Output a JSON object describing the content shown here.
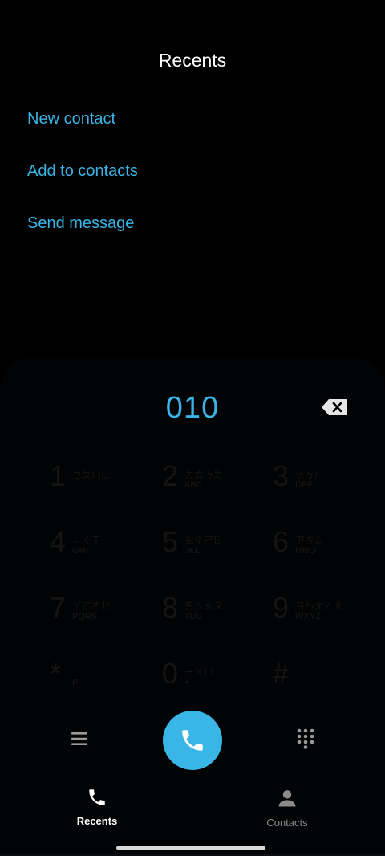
{
  "header": {
    "title": "Recents"
  },
  "menu": {
    "items": [
      {
        "label": "New contact"
      },
      {
        "label": "Add to contacts"
      },
      {
        "label": "Send message"
      }
    ]
  },
  "dialer": {
    "number": "010",
    "keys": [
      {
        "digit": "1",
        "zh": "ㄅㄆㄇㄈ",
        "en": ""
      },
      {
        "digit": "2",
        "zh": "ㄉㄊㄋㄌ",
        "en": "ABC"
      },
      {
        "digit": "3",
        "zh": "ㄍㄎㄏ",
        "en": "DEF"
      },
      {
        "digit": "4",
        "zh": "ㄐㄑㄒ",
        "en": "GHI"
      },
      {
        "digit": "5",
        "zh": "ㄓㄔㄕㄖ",
        "en": "JKL"
      },
      {
        "digit": "6",
        "zh": "ㄗㄘㄙ",
        "en": "MNO"
      },
      {
        "digit": "7",
        "zh": "ㄚㄛㄜㄝ",
        "en": "PQRS"
      },
      {
        "digit": "8",
        "zh": "ㄞㄟㄠㄡ",
        "en": "TUV"
      },
      {
        "digit": "9",
        "zh": "ㄢㄣㄤㄥㄦ",
        "en": "WXYZ"
      },
      {
        "digit": "*",
        "zh": "",
        "en": "P"
      },
      {
        "digit": "0",
        "zh": "ㄧㄨㄩ",
        "en": "+"
      },
      {
        "digit": "#",
        "zh": "",
        "en": ""
      }
    ]
  },
  "icons": {
    "backspace": "backspace-icon",
    "menu": "hamburger-menu-icon",
    "call": "phone-icon",
    "dialpad": "dialpad-icon"
  },
  "nav": {
    "recents": "Recents",
    "contacts": "Contacts"
  },
  "colors": {
    "accent": "#3ab3e6",
    "background": "#000000"
  }
}
